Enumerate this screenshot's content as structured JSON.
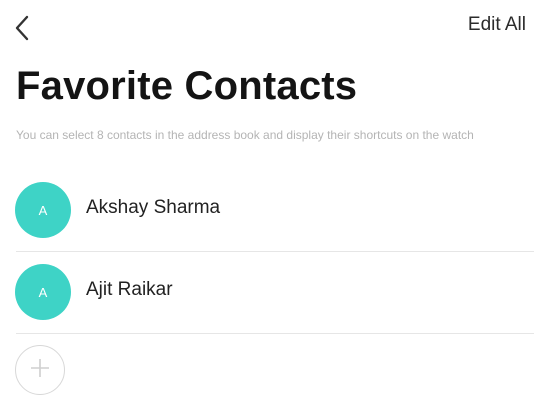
{
  "header": {
    "back_icon": "chevron-left-icon",
    "edit_all_label": "Edit All"
  },
  "page": {
    "title": "Favorite Contacts",
    "description": "You can select 8 contacts in the address book and display their shortcuts on the watch"
  },
  "contacts": [
    {
      "initial": "A",
      "name": "Akshay Sharma"
    },
    {
      "initial": "A",
      "name": "Ajit Raikar"
    }
  ],
  "add_button": {
    "icon": "plus-icon"
  },
  "colors": {
    "avatar_bg": "#3ed3c6",
    "title_text": "#141414",
    "description_text": "#b4b4b4",
    "divider": "#e6e6e6"
  }
}
